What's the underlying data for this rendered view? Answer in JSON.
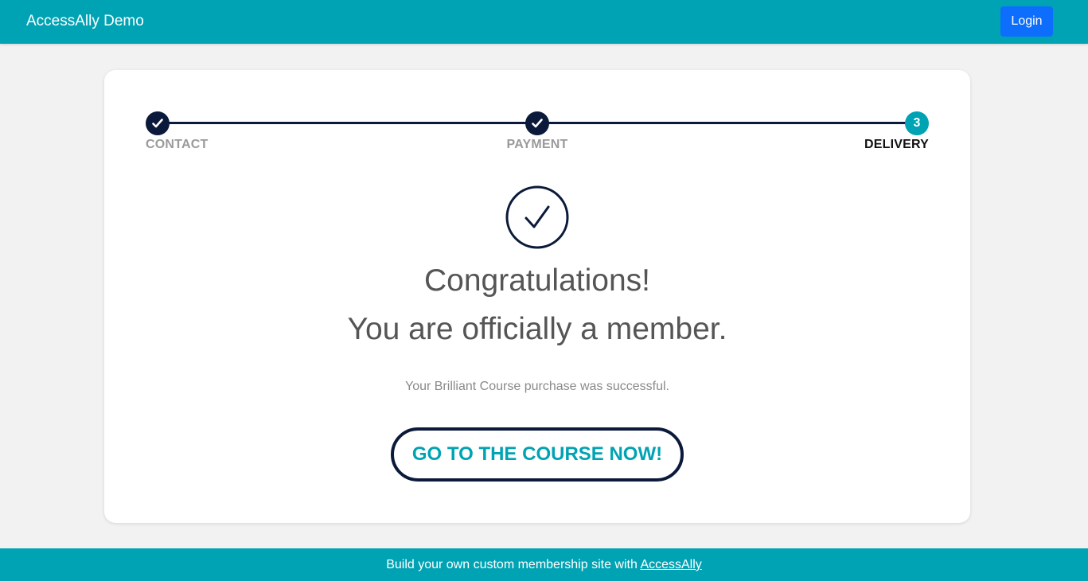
{
  "header": {
    "brand": "AccessAlly Demo",
    "login_label": "Login"
  },
  "progress": {
    "steps": [
      {
        "label": "CONTACT",
        "state": "done"
      },
      {
        "label": "PAYMENT",
        "state": "done"
      },
      {
        "label": "DELIVERY",
        "state": "active",
        "number": "3"
      }
    ]
  },
  "main": {
    "heading_line1": "Congratulations!",
    "heading_line2": "You are officially a member.",
    "message": "Your Brilliant Course purchase was successful.",
    "cta_label": "GO TO THE COURSE NOW!"
  },
  "footer": {
    "text": "Build your own custom membership site with ",
    "link_label": "AccessAlly"
  },
  "colors": {
    "brand_teal": "#00a3b4",
    "navy": "#0b1a3a",
    "login_blue": "#0d6efd"
  }
}
